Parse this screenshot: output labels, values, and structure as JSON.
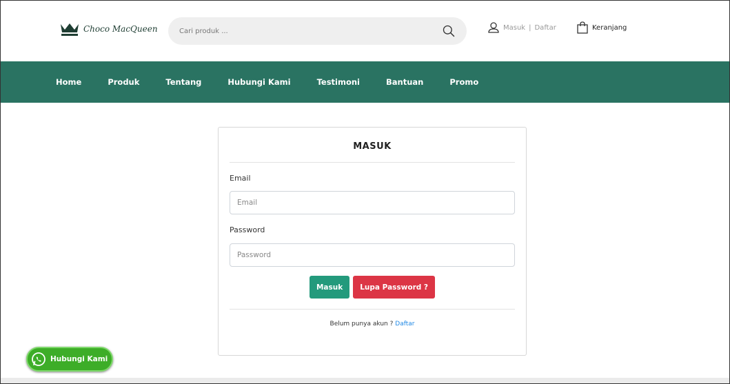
{
  "brand": {
    "name": "Choco MacQueen",
    "color": "#1e3d32"
  },
  "search": {
    "placeholder": "Cari produk ...",
    "icon": "search-icon"
  },
  "account": {
    "login_label": "Masuk",
    "separator": "|",
    "register_label": "Daftar",
    "icon": "user-icon"
  },
  "cart": {
    "label": "Keranjang",
    "icon": "shopping-bag-icon"
  },
  "nav": {
    "background": "#2a7362",
    "items": [
      {
        "label": "Home"
      },
      {
        "label": "Produk"
      },
      {
        "label": "Tentang"
      },
      {
        "label": "Hubungi Kami"
      },
      {
        "label": "Testimoni"
      },
      {
        "label": "Bantuan"
      },
      {
        "label": "Promo"
      }
    ]
  },
  "login_form": {
    "title": "MASUK",
    "email_label": "Email",
    "email_placeholder": "Email",
    "email_value": "",
    "password_label": "Password",
    "password_placeholder": "Password",
    "password_value": "",
    "submit_label": "Masuk",
    "forgot_label": "Lupa Password ?",
    "register_prompt": "Belum punya akun ?",
    "register_link": "Daftar"
  },
  "colors": {
    "primary": "#239a7c",
    "danger": "#dc3545",
    "link": "#1e88e5",
    "whatsapp": "#3dad28"
  },
  "whatsapp": {
    "label": "Hubungi Kami",
    "icon": "whatsapp-icon"
  }
}
